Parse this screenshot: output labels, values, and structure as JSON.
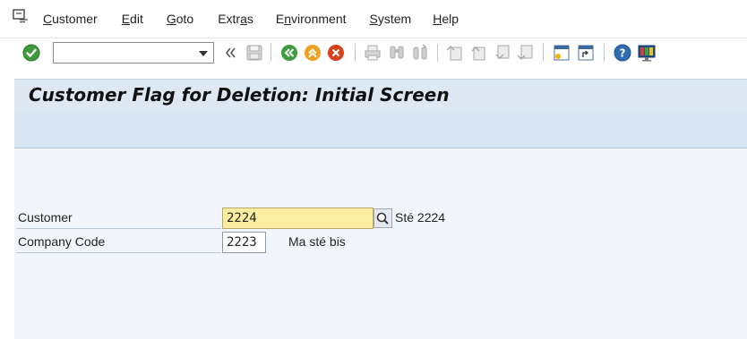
{
  "menubar": {
    "items": [
      {
        "label": "Customer"
      },
      {
        "label": "Edit"
      },
      {
        "label": "Goto"
      },
      {
        "label": "Extras"
      },
      {
        "label": "Environment"
      },
      {
        "label": "System"
      },
      {
        "label": "Help"
      }
    ]
  },
  "toolbar": {
    "command_field_value": "",
    "icons": [
      "enter-icon",
      "command-dropdown-icon",
      "collapse-icon",
      "save-icon",
      "back-icon",
      "exit-icon",
      "cancel-icon",
      "print-icon",
      "find-icon",
      "find-next-icon",
      "first-page-icon",
      "previous-page-icon",
      "next-page-icon",
      "last-page-icon",
      "new-session-icon",
      "shortcut-icon",
      "help-icon",
      "layout-menu-icon"
    ]
  },
  "screen": {
    "title": "Customer Flag for Deletion: Initial Screen"
  },
  "form": {
    "customer": {
      "label": "Customer",
      "value": "2224",
      "description": "Sté 2224"
    },
    "company_code": {
      "label": "Company Code",
      "value": "2223",
      "description": "Ma sté bis"
    }
  },
  "colors": {
    "title_background": "#dde8f3",
    "content_background": "#f2f6fa",
    "focused_field": "#fbeea0"
  }
}
